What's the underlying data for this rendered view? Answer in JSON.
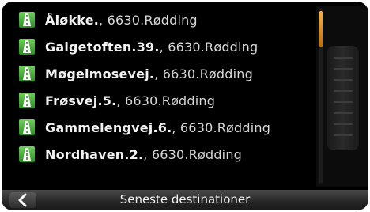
{
  "header": {
    "title": "Seneste destinationer"
  },
  "destinations": [
    {
      "street": "Åløkke.",
      "city": ", 6630.Rødding"
    },
    {
      "street": "Galgetoften.39.",
      "city": ", 6630.Rødding"
    },
    {
      "street": "Møgelmosevej.",
      "city": ", 6630.Rødding"
    },
    {
      "street": "Frøsvej.5.",
      "city": ", 6630.Rødding"
    },
    {
      "street": "Gammelengvej.6.",
      "city": ", 6630.Rødding"
    },
    {
      "street": "Nordhaven.2.",
      "city": ", 6630.Rødding"
    }
  ],
  "colors": {
    "icon": "#3aa830",
    "scroll_thumb": "#f09a1a",
    "background": "#000000"
  },
  "icons": {
    "row": "road-icon",
    "back": "back-arrow-icon"
  },
  "scroll": {
    "position_fraction": 0.0
  }
}
